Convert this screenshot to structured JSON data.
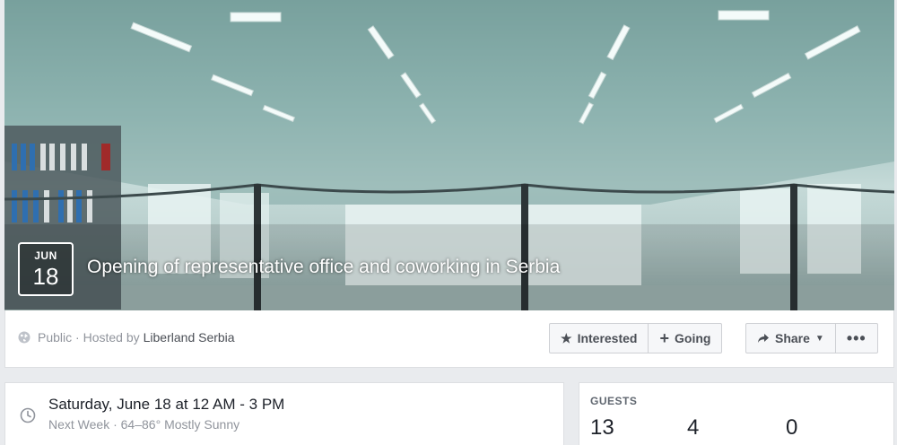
{
  "event": {
    "month": "JUN",
    "day": "18",
    "title": "Opening of representative office and coworking in Serbia"
  },
  "info_bar": {
    "privacy": "Public",
    "hosted_by_prefix": "· Hosted by",
    "host": "Liberland Serbia",
    "buttons": {
      "interested": "Interested",
      "going": "Going",
      "share": "Share",
      "more": "•••"
    }
  },
  "when": {
    "datetime": "Saturday, June 18 at 12 AM - 3 PM",
    "subtext": "Next Week · 64–86° Mostly Sunny"
  },
  "guests": {
    "label": "GUESTS",
    "counts": [
      "13",
      "4",
      "0"
    ]
  },
  "icons": {
    "privacy": "globe-icon",
    "interested": "star-icon",
    "going": "plus-icon",
    "share": "share-arrow-icon",
    "share_caret": "caret-down-icon",
    "when": "clock-icon"
  },
  "colors": {
    "page_bg": "#e9ebee",
    "link": "#4b4f56",
    "muted": "#90949c"
  }
}
